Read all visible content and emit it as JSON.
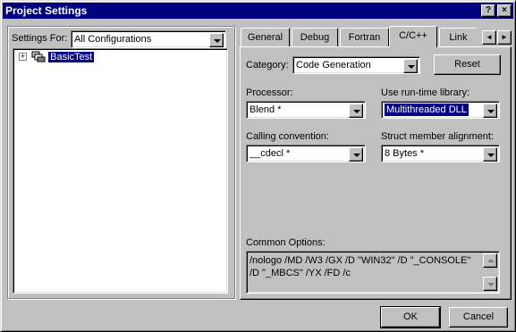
{
  "window": {
    "title": "Project Settings",
    "help_button": "?",
    "close_button": "×"
  },
  "left": {
    "settings_for_label": "Settings For:",
    "settings_for_value": "All Configurations",
    "tree": [
      {
        "expander": "+",
        "label": "BasicTest",
        "selected": true
      }
    ]
  },
  "tabs": [
    "General",
    "Debug",
    "Fortran",
    "C/C++",
    "Link"
  ],
  "active_tab": "C/C++",
  "tab_scroll": {
    "left": "◄",
    "right": "►"
  },
  "cpp": {
    "category_label": "Category:",
    "category_value": "Code Generation",
    "reset_label": "Reset",
    "processor_label": "Processor:",
    "processor_value": "Blend *",
    "runtime_label": "Use run-time library:",
    "runtime_value": "Multithreaded DLL",
    "calling_label": "Calling convention:",
    "calling_value": "__cdecl *",
    "struct_label": "Struct member alignment:",
    "struct_value": "8 Bytes *",
    "common_options_label": "Common Options:",
    "common_options_line1": "/nologo /MD /W3 /GX /D \"WIN32\" /D \"_CONSOLE\"",
    "common_options_line2": "/D \"_MBCS\" /YX /FD /c"
  },
  "footer": {
    "ok_label": "OK",
    "cancel_label": "Cancel"
  }
}
